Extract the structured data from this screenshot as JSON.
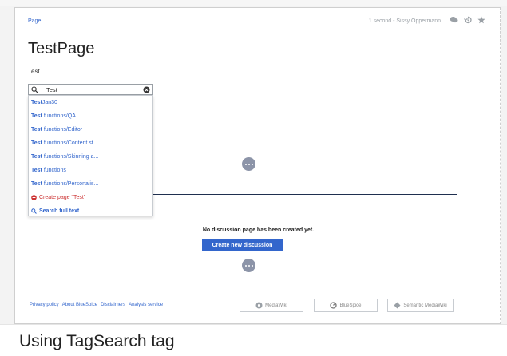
{
  "topbar": {
    "page_link": "Page",
    "meta": "1 second - Sissy Oppermann"
  },
  "page": {
    "title": "TestPage",
    "subtext": "Test"
  },
  "search": {
    "value": "Test",
    "results": [
      {
        "bold": "Test",
        "rest": "Jan30"
      },
      {
        "bold": "Test",
        "rest": " functions/QA"
      },
      {
        "bold": "Test",
        "rest": " functions/Editor"
      },
      {
        "bold": "Test",
        "rest": " functions/Content st..."
      },
      {
        "bold": "Test",
        "rest": " functions/Skinning a..."
      },
      {
        "bold": "Test",
        "rest": " functions"
      },
      {
        "bold": "Test",
        "rest": " functions/Personalis..."
      }
    ],
    "create_label": "Create page \"Test\"",
    "fulltext_label": "Search full text"
  },
  "discussion": {
    "empty_text": "No discussion page has been created yet.",
    "create_button": "Create new discussion"
  },
  "footer": {
    "links": [
      "Privacy policy",
      "About BlueSpice",
      "Disclaimers",
      "Analysis service"
    ],
    "badges": [
      "MediaWiki",
      "BlueSpice",
      "Semantic MediaWiki"
    ]
  },
  "caption": "Using TagSearch tag",
  "colors": {
    "link": "#3366cc",
    "primary_button": "#3366cc",
    "create_red": "#cc3333"
  },
  "icons": [
    "discussion-icon",
    "history-icon",
    "star-icon",
    "search-icon",
    "clear-icon",
    "plus-circle-icon",
    "more-dots-icon"
  ]
}
